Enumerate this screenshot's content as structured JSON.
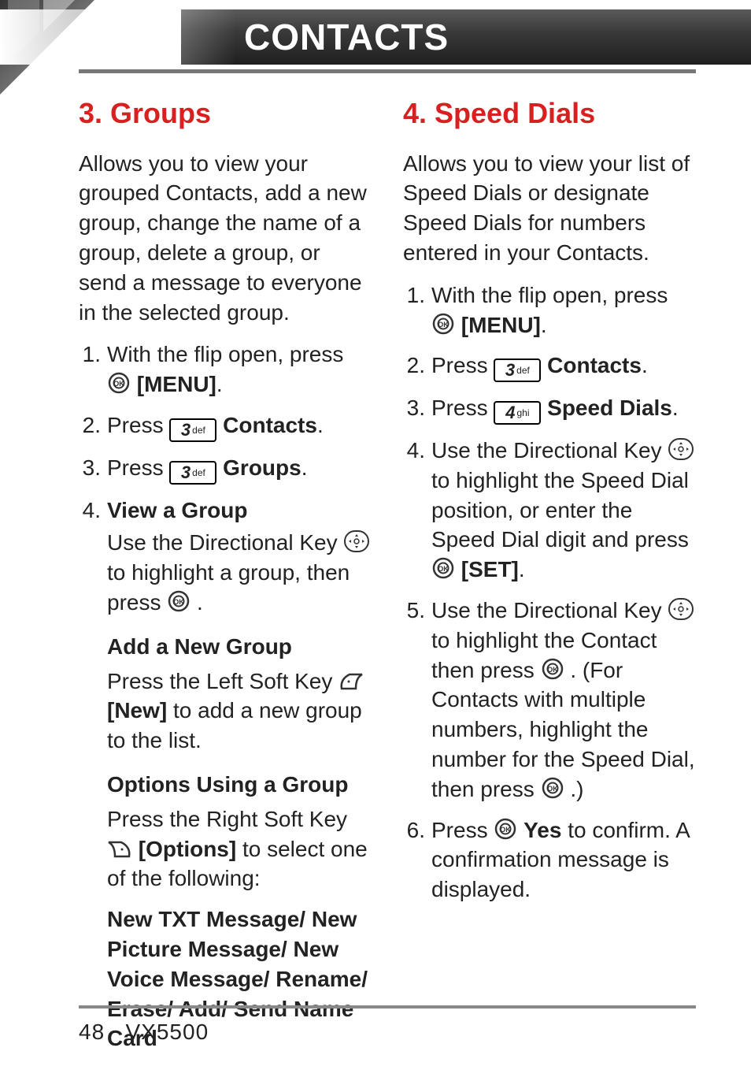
{
  "page_title": "CONTACTS",
  "left": {
    "heading": "3. Groups",
    "intro": "Allows you to view your grouped Contacts, add a new group, change the name of a group, delete a group, or send a message to everyone in the selected group.",
    "steps": {
      "s1a": "With the flip open, press ",
      "s1b": "[MENU]",
      "s1c": ".",
      "s2a": "Press ",
      "s2b": "Contacts",
      "s2c": ".",
      "s3a": "Press ",
      "s3b": "Groups",
      "s3c": ".",
      "s4a": "View a Group",
      "s4b": "Use the Directional Key ",
      "s4c": " to highlight a group, then press ",
      "s4d": " .",
      "sub1": "Add a New Group",
      "sub1a": "Press the Left Soft Key ",
      "sub1b": "[New]",
      "sub1c": " to add a new group to the list.",
      "sub2": "Options Using a Group",
      "sub2a": "Press the Right Soft Key ",
      "sub2b": "[Options]",
      "sub2c": " to select one of the following:",
      "opts": "New TXT Message/ New Picture Message/ New Voice Message/ Rename/ Erase/ Add/ Send Name Card"
    }
  },
  "right": {
    "heading": "4. Speed Dials",
    "intro": "Allows you to view your list of Speed Dials or designate Speed Dials for numbers entered in your Contacts.",
    "steps": {
      "s1a": "With the flip open, press ",
      "s1b": "[MENU]",
      "s1c": ".",
      "s2a": "Press ",
      "s2b": "Contacts",
      "s2c": ".",
      "s3a": "Press ",
      "s3b": "Speed Dials",
      "s3c": ".",
      "s4a": "Use the Directional Key ",
      "s4b": " to highlight the Speed Dial position, or enter the Speed Dial digit and press ",
      "s4c": "[SET]",
      "s4d": ".",
      "s5a": "Use the Directional Key ",
      "s5b": " to highlight the Contact then press ",
      "s5c": " . (For Contacts with multiple numbers, highlight the number for the Speed Dial, then press ",
      "s5d": " .)",
      "s6a": "Press ",
      "s6b": "Yes",
      "s6c": " to confirm. A confirmation message is displayed."
    }
  },
  "keys": {
    "k3n": "3",
    "k3s": "def",
    "k4n": "4",
    "k4s": "ghi"
  },
  "nums": {
    "n1": "1.",
    "n2": "2.",
    "n3": "3.",
    "n4": "4.",
    "n5": "5.",
    "n6": "6."
  },
  "footer": {
    "page": "48",
    "model": "VX5500"
  }
}
